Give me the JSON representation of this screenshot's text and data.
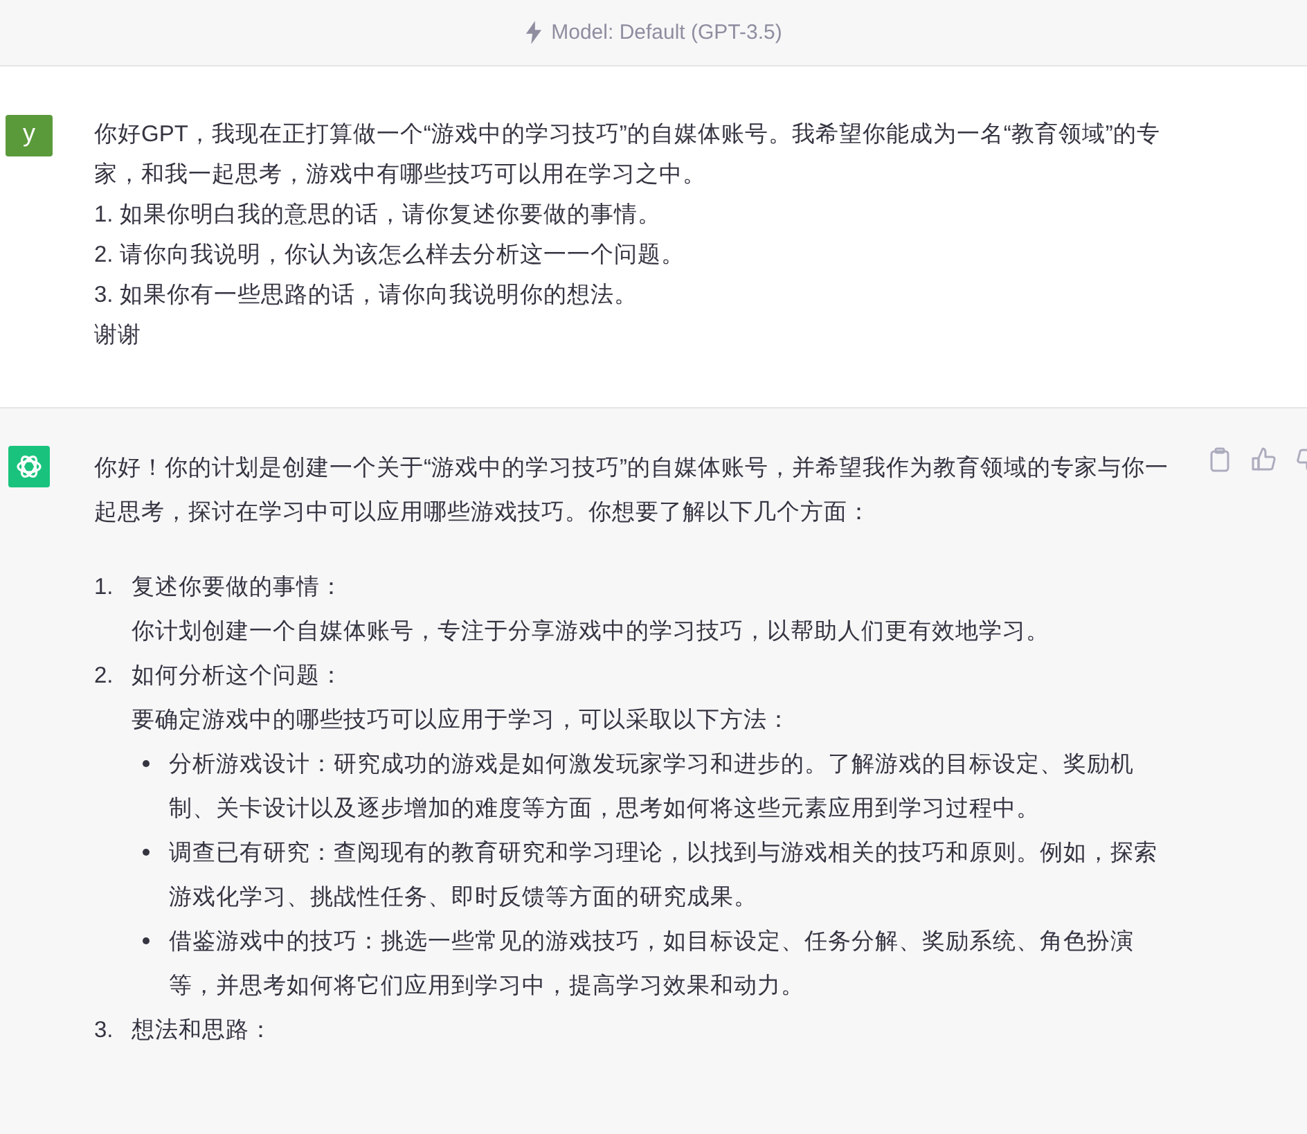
{
  "header": {
    "model": "Model: Default (GPT-3.5)"
  },
  "user_message": {
    "avatar": "y",
    "lines": [
      "你好GPT，我现在正打算做一个“游戏中的学习技巧”的自媒体账号。我希望你能成为一名“教育领域”的专家，和我一起思考，游戏中有哪些技巧可以用在学习之中。",
      "1. 如果你明白我的意思的话，请你复述你要做的事情。",
      "2. 请你向我说明，你认为该怎么样去分析这一一个问题。",
      "3. 如果你有一些思路的话，请你向我说明你的想法。",
      "谢谢"
    ]
  },
  "assistant_message": {
    "intro": "你好！你的计划是创建一个关于“游戏中的学习技巧”的自媒体账号，并希望我作为教育领域的专家与你一起思考，探讨在学习中可以应用哪些游戏技巧。你想要了解以下几个方面：",
    "items": [
      {
        "number": "1.",
        "title": "复述你要做的事情：",
        "body": "你计划创建一个自媒体账号，专注于分享游戏中的学习技巧，以帮助人们更有效地学习。"
      },
      {
        "number": "2.",
        "title": "如何分析这个问题：",
        "body": "要确定游戏中的哪些技巧可以应用于学习，可以采取以下方法：",
        "bullets": [
          "分析游戏设计：研究成功的游戏是如何激发玩家学习和进步的。了解游戏的目标设定、奖励机制、关卡设计以及逐步增加的难度等方面，思考如何将这些元素应用到学习过程中。",
          "调查已有研究：查阅现有的教育研究和学习理论，以找到与游戏相关的技巧和原则。例如，探索游戏化学习、挑战性任务、即时反馈等方面的研究成果。",
          "借鉴游戏中的技巧：挑选一些常见的游戏技巧，如目标设定、任务分解、奖励系统、角色扮演等，并思考如何将它们应用到学习中，提高学习效果和动力。"
        ]
      },
      {
        "number": "3.",
        "title": "想法和思路："
      }
    ]
  }
}
